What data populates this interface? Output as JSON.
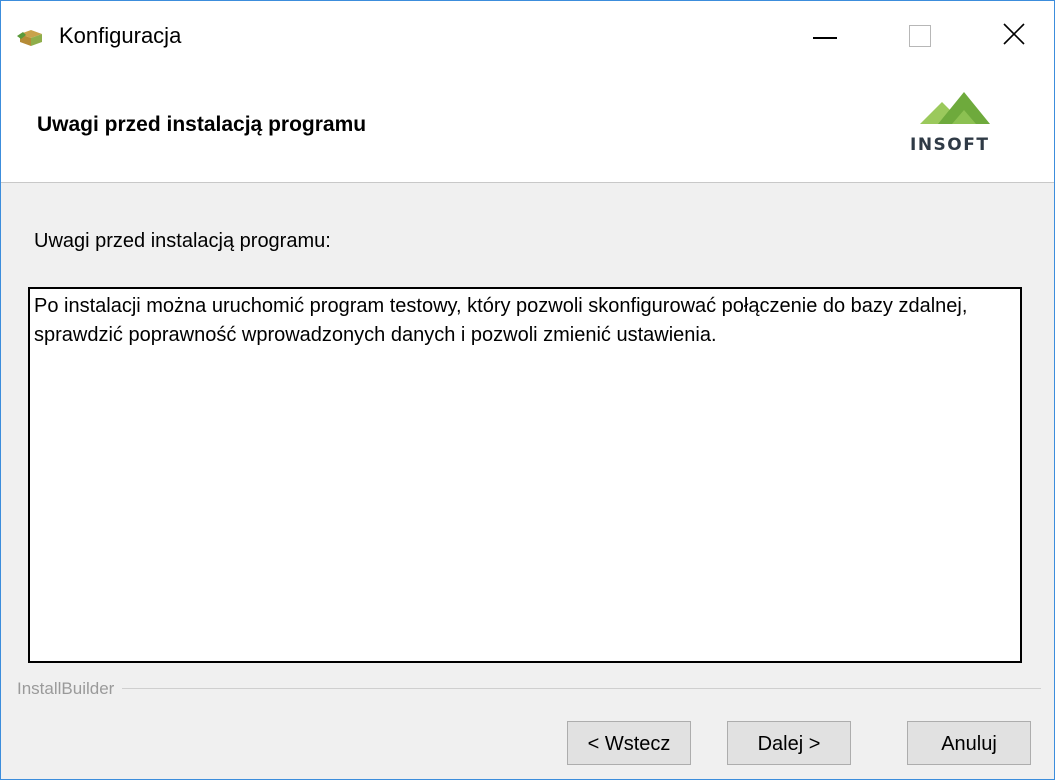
{
  "window": {
    "title": "Konfiguracja"
  },
  "header": {
    "title": "Uwagi przed instalacją programu",
    "logo_text": "INSOFT"
  },
  "content": {
    "label": "Uwagi przed instalacją programu:",
    "notes": "Po instalacji można uruchomić program testowy, który pozwoli skonfigurować połączenie do bazy zdalnej, sprawdzić poprawność wprowadzonych danych i pozwoli zmienić ustawienia."
  },
  "footer": {
    "vendor": "InstallBuilder",
    "back_label": "< Wstecz",
    "next_label": "Dalej >",
    "cancel_label": "Anuluj"
  },
  "colors": {
    "window_border": "#3c8ddc",
    "logo_green": "#7ab648",
    "logo_text": "#2f3a46"
  },
  "icons": {
    "app": "installer-box-icon",
    "minimize": "minimize-icon",
    "maximize": "maximize-icon",
    "close": "close-icon"
  }
}
